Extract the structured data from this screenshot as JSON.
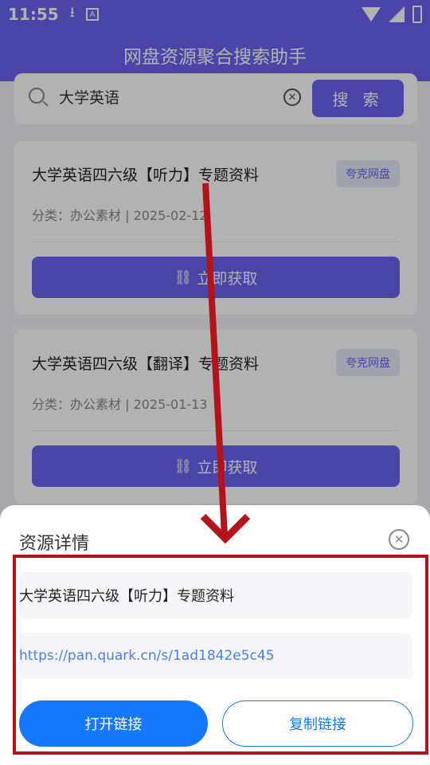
{
  "status": {
    "time": "11:55",
    "download_icon": "download-icon",
    "app_icon_letter": "A"
  },
  "header": {
    "title": "网盘资源聚合搜索助手"
  },
  "search": {
    "value": "大学英语",
    "button_label": "搜 索"
  },
  "results": [
    {
      "title": "大学英语四六级【听力】专题资料",
      "badge": "夸克网盘",
      "meta": "分类：办公素材 | 2025-02-12",
      "button_label": "立即获取"
    },
    {
      "title": "大学英语四六级【翻译】专题资料",
      "badge": "夸克网盘",
      "meta": "分类：办公素材 | 2025-01-13",
      "button_label": "立即获取"
    }
  ],
  "sheet": {
    "title": "资源详情",
    "resource_title": "大学英语四六级【听力】专题资料",
    "url": "https://pan.quark.cn/s/1ad1842e5c45",
    "open_label": "打开链接",
    "copy_label": "复制链接"
  },
  "colors": {
    "primary": "#6c63f0",
    "sheet_primary": "#1677ff",
    "annotation": "#b3141b"
  }
}
